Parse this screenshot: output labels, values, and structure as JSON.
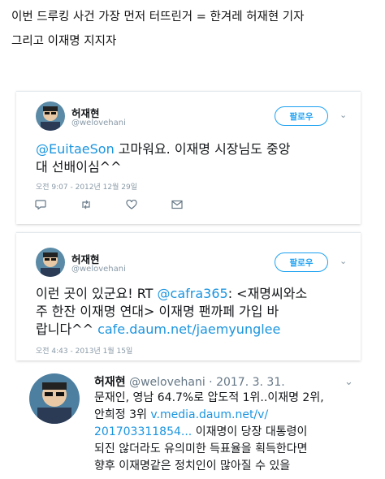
{
  "headline": {
    "line1": "이번 드루킹 사건 가장 먼저 터뜨린거 = 한겨레 허재현 기자",
    "line2": "그리고 이재명 지지자"
  },
  "tweet1": {
    "name": "허재현",
    "handle": "@welovehani",
    "follow_label": "팔로우",
    "mention": "@EuitaeSon",
    "text_line1_rest": " 고마워요. 이재명 시장님도 중앙",
    "text_line2": "대 선배이심^^",
    "time": "오전 9:07 - 2012년 12월 29일"
  },
  "tweet2": {
    "name": "허재현",
    "handle": "@welovehani",
    "follow_label": "팔로우",
    "text_line1_a": "이런 곳이 있군요! RT ",
    "text_line1_mention": "@cafra365",
    "text_line1_b": ": <재명씨와소",
    "text_line2": "주 한잔 이재명 연대> 이재명 팬까페 가입 바",
    "text_line3_a": "랍니다^^ ",
    "text_line3_link": "cafe.daum.net/jaemyunglee",
    "time": "오전 4:43 - 2013년 1월 15일"
  },
  "tweet3": {
    "name": "허재현",
    "handle": "@welovehani · 2017. 3. 31.",
    "line1": "문재인, 영남 64.7%로 압도적 1위..이재명 2위,",
    "line2_a": "안희정 3위 ",
    "line2_link": "v.media.daum.net/v/",
    "line3_link": "201703311854...",
    "line3_b": " 이재명이 당장 대통령이",
    "line4": "되진 않더라도 유의미한 득표율을 획득한다면",
    "line5": "향후 이재명같은 정치인이 많아질 수 있을"
  },
  "icons": [
    "reply-icon",
    "retweet-icon",
    "like-icon",
    "dm-icon",
    "caret-down-icon"
  ],
  "colors": {
    "link": "#1b95e0",
    "follow_border": "#1da1f2",
    "muted": "#8899a6"
  }
}
